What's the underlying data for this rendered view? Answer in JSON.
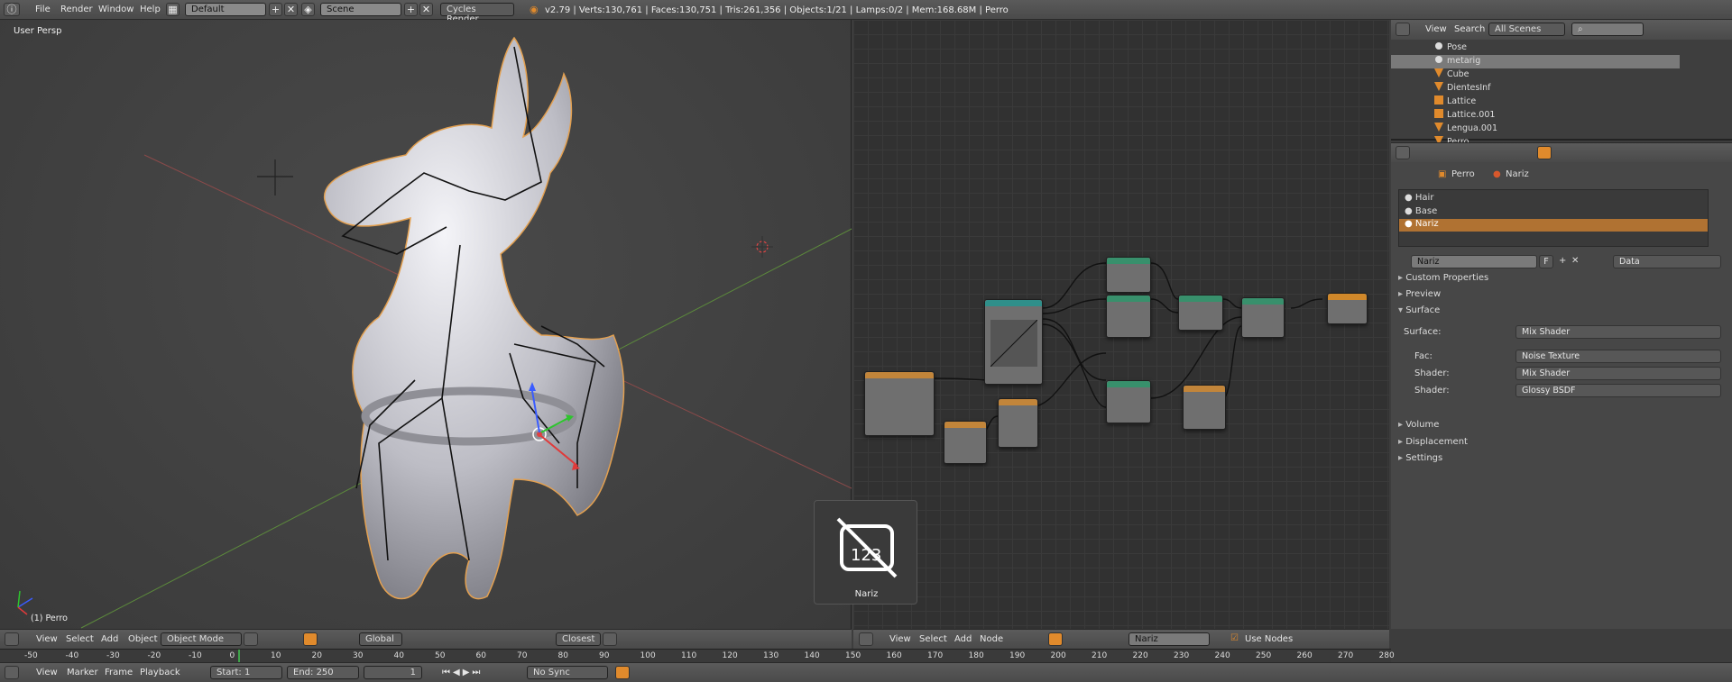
{
  "topbar": {
    "menus": [
      "File",
      "Render",
      "Window",
      "Help"
    ],
    "layout": "Default",
    "scene": "Scene",
    "engine": "Cycles Render",
    "info": "v2.79 | Verts:130,761 | Faces:130,751 | Tris:261,356 | Objects:1/21 | Lamps:0/2 | Mem:168.68M | Perro"
  },
  "viewport": {
    "label": "User Persp",
    "object_label": "(1) Perro",
    "menus": [
      "View",
      "Select",
      "Add",
      "Object"
    ],
    "mode": "Object Mode",
    "orientation": "Global",
    "snap": "Closest"
  },
  "node_editor": {
    "menus": [
      "View",
      "Select",
      "Add",
      "Node"
    ],
    "material": "Nariz",
    "use_nodes": "Use Nodes",
    "badge_text": "123",
    "badge_label": "Nariz"
  },
  "outliner": {
    "menus": [
      "View",
      "Search"
    ],
    "scenes": "All Scenes",
    "items": [
      "Pose",
      "metarig",
      "Cube",
      "DientesInf",
      "Lattice",
      "Lattice.001",
      "Lengua.001",
      "Perro"
    ]
  },
  "properties": {
    "crumb_object": "Perro",
    "crumb_material": "Nariz",
    "slots": [
      "Hair",
      "Base",
      "Nariz"
    ],
    "material_name": "Nariz",
    "link": "Data",
    "f_label": "F",
    "sections": {
      "custom": "Custom Properties",
      "preview": "Preview",
      "surface": "Surface",
      "volume": "Volume",
      "displacement": "Displacement",
      "settings": "Settings"
    },
    "surface": {
      "surface_label": "Surface:",
      "surface_value": "Mix Shader",
      "fac_label": "Fac:",
      "fac_value": "Noise Texture",
      "shader1_label": "Shader:",
      "shader1_value": "Mix Shader",
      "shader2_label": "Shader:",
      "shader2_value": "Glossy BSDF"
    }
  },
  "timeline": {
    "menus": [
      "View",
      "Marker",
      "Frame",
      "Playback"
    ],
    "start_label": "Start:",
    "start": "1",
    "end_label": "End:",
    "end": "250",
    "current": "1",
    "sync": "No Sync",
    "ticks": [
      "-50",
      "-40",
      "-30",
      "-20",
      "-10",
      "0",
      "10",
      "20",
      "30",
      "40",
      "50",
      "60",
      "70",
      "80",
      "90",
      "100",
      "110",
      "120",
      "130",
      "140",
      "150",
      "160",
      "170",
      "180",
      "190",
      "200",
      "210",
      "220",
      "230",
      "240",
      "250",
      "260",
      "270",
      "280"
    ]
  },
  "colors": {
    "accent": "#e08a2c",
    "selected_slot": "#b07232",
    "header": "#4a4a4a",
    "node_bg": "#313131"
  }
}
